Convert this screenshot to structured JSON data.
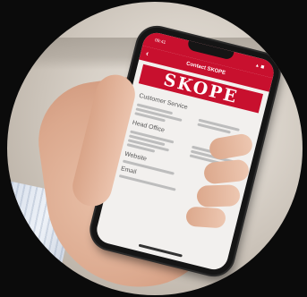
{
  "scene": {
    "description_hidden": "",
    "app": {
      "status_time": "09:41",
      "status_icons": "▲ ◼",
      "nav_title": "Contact SKOPE",
      "logo_text": "SKOPE",
      "section_1_title": "Customer Service",
      "section_2_title": "Head Office",
      "section_3_title": "Website",
      "section_4_title": "Email"
    },
    "colors": {
      "brand_red": "#c8102e",
      "background": "#0b0b0b"
    }
  }
}
